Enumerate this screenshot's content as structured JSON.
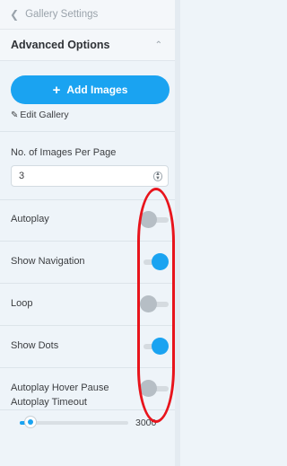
{
  "header": {
    "title": "Gallery Settings"
  },
  "section": {
    "title": "Advanced Options"
  },
  "actions": {
    "add_images_label": "Add Images",
    "edit_gallery_label": "Edit Gallery"
  },
  "images_per_page": {
    "label": "No. of Images Per Page",
    "value": "3"
  },
  "toggles": [
    {
      "label": "Autoplay",
      "on": false
    },
    {
      "label": "Show Navigation",
      "on": true
    },
    {
      "label": "Loop",
      "on": false
    },
    {
      "label": "Show Dots",
      "on": true
    },
    {
      "label": "Autoplay Hover Pause",
      "on": false
    }
  ],
  "autoplay_timeout": {
    "label": "Autoplay Timeout",
    "value": "3000",
    "fraction": 0.1
  },
  "colors": {
    "accent": "#1aa3f1",
    "annotation": "#e8141c"
  }
}
